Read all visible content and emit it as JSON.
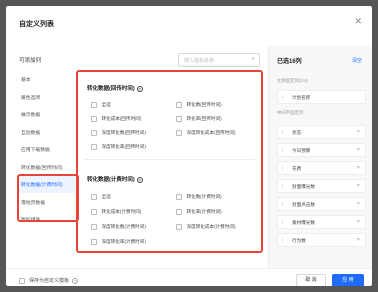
{
  "dialog": {
    "title": "自定义列表",
    "close_icon": "close-icon"
  },
  "available": {
    "title": "可添加列",
    "search_placeholder": "搜入指标名称"
  },
  "categories": [
    {
      "label": "基本"
    },
    {
      "label": "属性选项"
    },
    {
      "label": "展示数据"
    },
    {
      "label": "互动数据"
    },
    {
      "label": "应用下载数据"
    },
    {
      "label": "转化数据(回传时间)"
    },
    {
      "label": "转化数据(计费时间)"
    },
    {
      "label": "落地页数据"
    },
    {
      "label": "附加组件"
    }
  ],
  "groups": [
    {
      "title": "转化数据(回传时间)",
      "options": [
        [
          "全选",
          "转化数(回传时间)"
        ],
        [
          "转化成本(回传时间)",
          "转化率(回传时间)"
        ],
        [
          "深度转化数(回传时间)",
          "深度转化成本(回传时间)"
        ],
        [
          "深度转化率(回传时间)",
          ""
        ]
      ]
    },
    {
      "title": "转化数据(计费时间)",
      "options": [
        [
          "全选",
          "转化数(计费时间)"
        ],
        [
          "转化成本(计费时间)",
          "转化率(计费时间)"
        ],
        [
          "深度转化数(计费时间)",
          "深度转化成本(计费时间)"
        ],
        [
          "深度转化率(计费时间)",
          ""
        ]
      ]
    }
  ],
  "selected": {
    "title": "已选16列",
    "clear_label": "清空",
    "fixed_label": "左侧固定列(1/4)",
    "fixed_items": [
      {
        "label": "计划名称"
      }
    ],
    "unfixed_label": "中间不固定列",
    "items": [
      {
        "label": "状态"
      },
      {
        "label": "今日预算"
      },
      {
        "label": "花费"
      },
      {
        "label": "封面曝光数"
      },
      {
        "label": "封面点击数"
      },
      {
        "label": "素材曝光数"
      },
      {
        "label": "行为数"
      }
    ]
  },
  "footer": {
    "save_template_label": "保存为自定义模板",
    "cancel_label": "取 消",
    "apply_label": "应 用"
  }
}
